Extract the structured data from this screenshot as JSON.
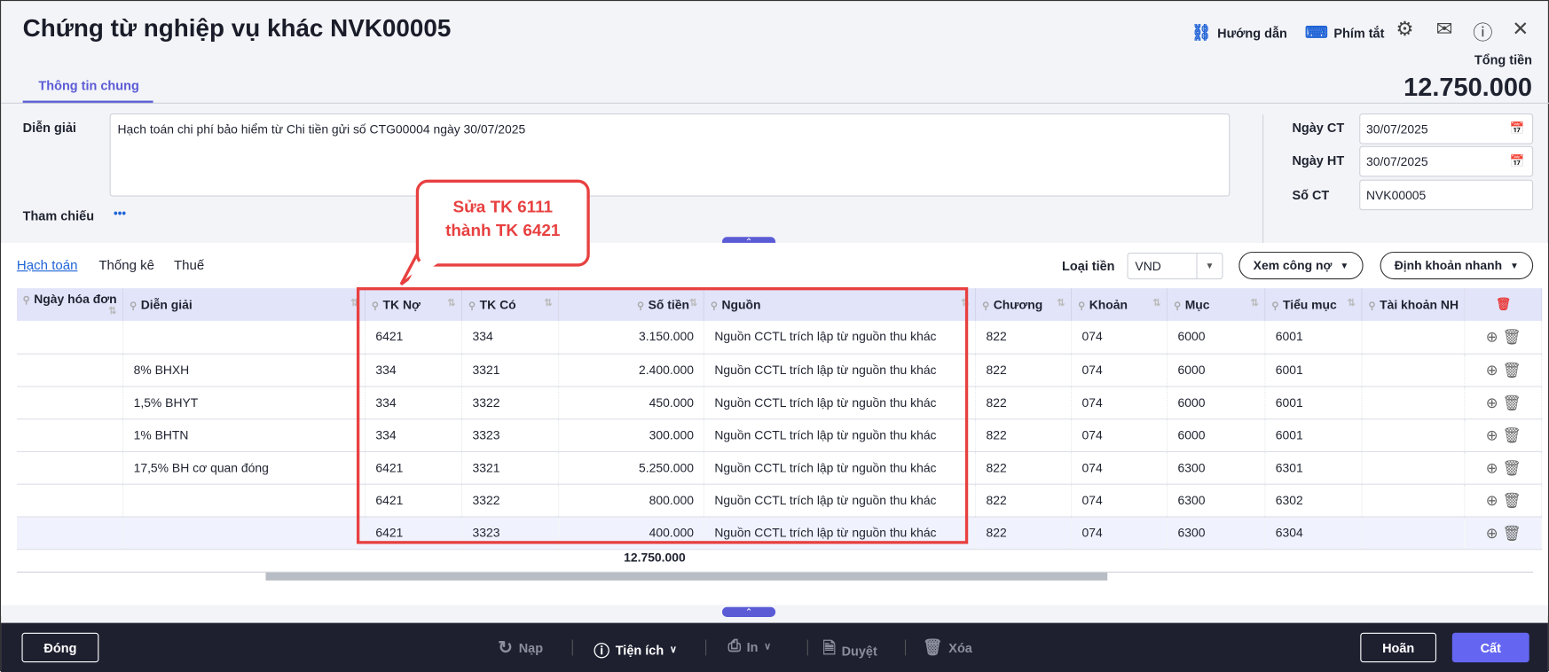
{
  "header": {
    "title": "Chứng từ nghiệp vụ khác NVK00005",
    "guide": "Hướng dẫn",
    "shortcuts": "Phím tắt",
    "total_label": "Tổng tiền",
    "total_value": "12.750.000",
    "tab": "Thông tin chung"
  },
  "form": {
    "desc_label": "Diễn giải",
    "desc_value": "Hạch toán chi phí bảo hiểm từ Chi tiền gửi số CTG00004 ngày 30/07/2025",
    "ref_label": "Tham chiếu",
    "ref_dots": "•••",
    "ngay_ct_label": "Ngày CT",
    "ngay_ct": "30/07/2025",
    "ngay_ht_label": "Ngày HT",
    "ngay_ht": "30/07/2025",
    "so_ct_label": "Số CT",
    "so_ct": "NVK00005"
  },
  "callout": {
    "line1": "Sửa TK 6111",
    "line2": "thành TK 6421"
  },
  "subtabs": [
    "Hạch toán",
    "Thống kê",
    "Thuế"
  ],
  "toolbar": {
    "currency_label": "Loại tiền",
    "currency": "VND",
    "debt_button": "Xem công nợ",
    "quick_button": "Định khoản nhanh"
  },
  "table": {
    "columns": [
      "Ngày hóa đơn",
      "Diễn giải",
      "TK Nợ",
      "TK Có",
      "Số tiền",
      "Nguồn",
      "Chương",
      "Khoản",
      "Mục",
      "Tiểu mục",
      "Tài khoản NH"
    ],
    "rows": [
      [
        "",
        "",
        "6421",
        "334",
        "3.150.000",
        "Nguồn CCTL trích lập từ nguồn thu khác",
        "822",
        "074",
        "6000",
        "6001",
        ""
      ],
      [
        "",
        "8% BHXH",
        "334",
        "3321",
        "2.400.000",
        "Nguồn CCTL trích lập từ nguồn thu khác",
        "822",
        "074",
        "6000",
        "6001",
        ""
      ],
      [
        "",
        "1,5% BHYT",
        "334",
        "3322",
        "450.000",
        "Nguồn CCTL trích lập từ nguồn thu khác",
        "822",
        "074",
        "6000",
        "6001",
        ""
      ],
      [
        "",
        "1% BHTN",
        "334",
        "3323",
        "300.000",
        "Nguồn CCTL trích lập từ nguồn thu khác",
        "822",
        "074",
        "6000",
        "6001",
        ""
      ],
      [
        "",
        "17,5% BH cơ quan đóng",
        "6421",
        "3321",
        "5.250.000",
        "Nguồn CCTL trích lập từ nguồn thu khác",
        "822",
        "074",
        "6300",
        "6301",
        ""
      ],
      [
        "",
        "",
        "6421",
        "3322",
        "800.000",
        "Nguồn CCTL trích lập từ nguồn thu khác",
        "822",
        "074",
        "6300",
        "6302",
        ""
      ],
      [
        "",
        "",
        "6421",
        "3323",
        "400.000",
        "Nguồn CCTL trích lập từ nguồn thu khác",
        "822",
        "074",
        "6300",
        "6304",
        ""
      ]
    ],
    "total": "12.750.000"
  },
  "footer": {
    "close": "Đóng",
    "reload": "Nạp",
    "utilities": "Tiện ích",
    "print": "In",
    "approve": "Duyệt",
    "delete": "Xóa",
    "cancel": "Hoãn",
    "save": "Cất"
  }
}
